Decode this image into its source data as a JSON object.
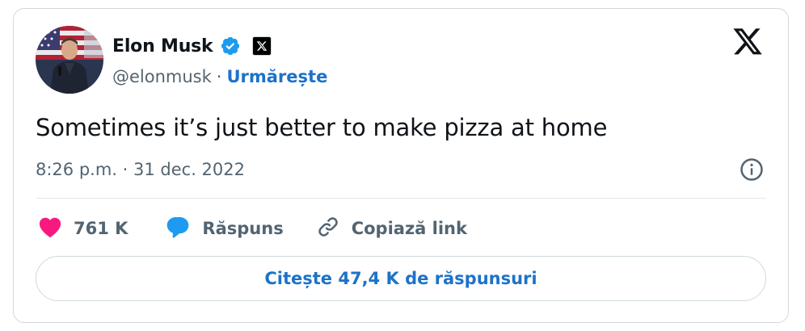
{
  "author": {
    "display_name": "Elon Musk",
    "handle": "@elonmusk",
    "separator": "·",
    "follow_label": "Urmărește",
    "avatar_icon": "user-avatar-photo",
    "verified_icon": "verified-badge-icon",
    "affiliate_icon": "x-affiliate-badge-icon"
  },
  "tweet": {
    "text": "Sometimes it’s just better to make pizza at home",
    "timestamp": "8:26 p.m. · 31 dec. 2022"
  },
  "actions": {
    "likes_count": "761 K",
    "reply_label": "Răspuns",
    "copy_link_label": "Copiază link"
  },
  "read_replies_label": "Citește 47,4 K de răspunsuri",
  "colors": {
    "accent": "#1d72c8",
    "verified": "#1d9bf0",
    "like": "#f91880",
    "reply": "#1d9bf0",
    "muted_text": "#536471",
    "border": "#cfd9de"
  }
}
